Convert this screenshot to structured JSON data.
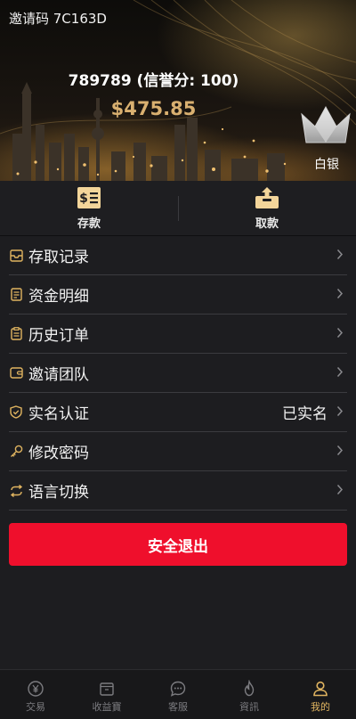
{
  "header": {
    "invite_code": "邀请码 7C163D",
    "user_line": "789789 (信誉分: 100)",
    "balance": "$475.85",
    "level": "白银"
  },
  "actions": [
    {
      "label": "存款",
      "icon": "deposit-icon"
    },
    {
      "label": "取款",
      "icon": "withdraw-icon"
    }
  ],
  "menu": [
    {
      "label": "存取记录",
      "icon": "inbox-icon"
    },
    {
      "label": "资金明细",
      "icon": "document-icon"
    },
    {
      "label": "历史订单",
      "icon": "clipboard-icon"
    },
    {
      "label": "邀请团队",
      "icon": "wallet-icon"
    },
    {
      "label": "实名认证",
      "icon": "shield-check-icon",
      "value": "已实名"
    },
    {
      "label": "修改密码",
      "icon": "key-icon"
    },
    {
      "label": "语言切换",
      "icon": "refresh-icon"
    }
  ],
  "logout_label": "安全退出",
  "tabbar": [
    {
      "label": "交易",
      "icon": "yen-coin-icon"
    },
    {
      "label": "收益寶",
      "icon": "wallet-box-icon"
    },
    {
      "label": "客服",
      "icon": "chat-icon"
    },
    {
      "label": "資訊",
      "icon": "flame-icon"
    },
    {
      "label": "我的",
      "icon": "user-icon",
      "active": true
    }
  ],
  "colors": {
    "accent_gold": "#e0b460",
    "balance_gold": "#d9b070",
    "logout_red": "#ef0f2c",
    "background": "#1d1d20"
  }
}
